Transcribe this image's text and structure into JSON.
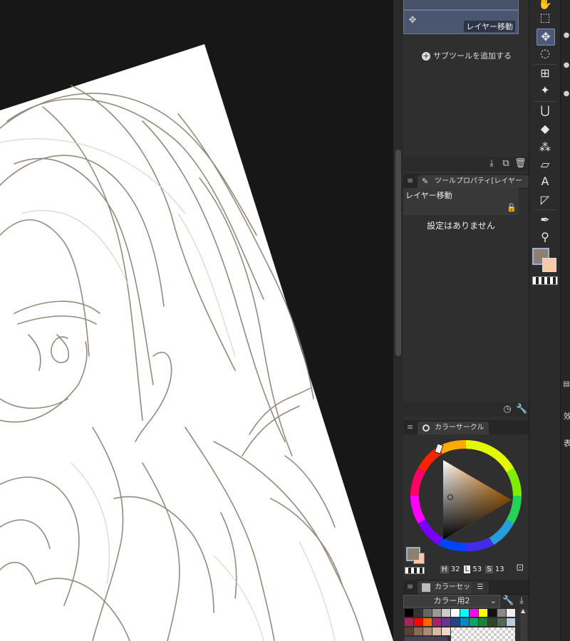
{
  "subtool": {
    "item_label": "レイヤー移動",
    "add_label": "サブツールを追加する"
  },
  "tool_property": {
    "tab_label": "ツールプロパティ[レイヤー移動]",
    "tool_name": "レイヤー移動",
    "empty_message": "設定はありません"
  },
  "color_circle": {
    "tab_label": "カラーサークル",
    "h_label": "H",
    "h_value": "32",
    "l_label": "L",
    "l_value": "53",
    "s_label": "S",
    "s_value": "13",
    "main_color": "#8c8070",
    "sub_color": "#f8c8aa"
  },
  "color_set": {
    "tab_label": "カラーセット",
    "selected_set": "カラー用2"
  },
  "colors": {
    "canvas_bg": "#171717",
    "panel_bg": "#2f2f2f",
    "accent": "#4d5a77",
    "paper": "#ffffff",
    "sketch_line": "#8a7d70"
  },
  "right_edge": {
    "text1": "效",
    "text2": "表"
  }
}
